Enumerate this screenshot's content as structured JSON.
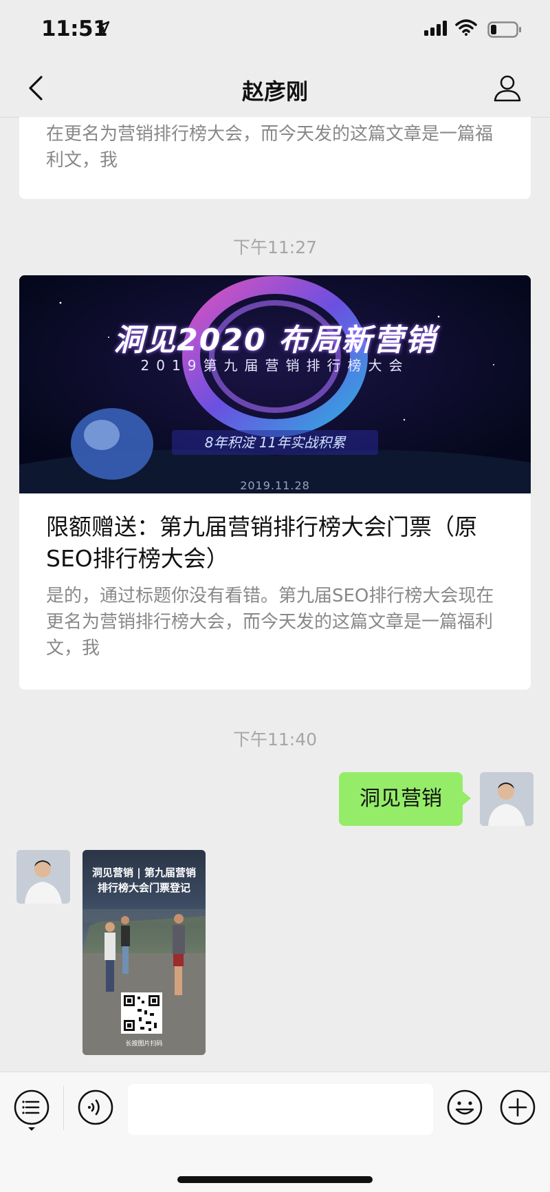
{
  "status_bar": {
    "time": "11:51"
  },
  "nav": {
    "title": "赵彦刚"
  },
  "messages": {
    "prev_card": {
      "digest": "在更名为营销排行榜大会，而今天发的这篇文章是一篇福利文，我"
    },
    "timestamp_1": "下午11:27",
    "article_card": {
      "banner_title": "洞见2020 布局新营销",
      "banner_subtitle": "2019第九届营销排行榜大会",
      "banner_tag": "8年积淀  11年实战积累",
      "banner_date": "2019.11.28",
      "title": "限额赠送：第九届营销排行榜大会门票（原SEO排行榜大会）",
      "digest": "是的，通过标题你没有看错。第九届SEO排行榜大会现在更名为营销排行榜大会，而今天发的这篇文章是一篇福利文，我"
    },
    "timestamp_2": "下午11:40",
    "sent_text": "洞见营销",
    "poster": {
      "title": "洞见营销 | 第九届营销排行榜大会门票登记",
      "caption": "长按图片扫码"
    }
  },
  "input": {
    "placeholder": ""
  },
  "colors": {
    "bubble_self": "#95ec69",
    "background": "#ededed"
  }
}
